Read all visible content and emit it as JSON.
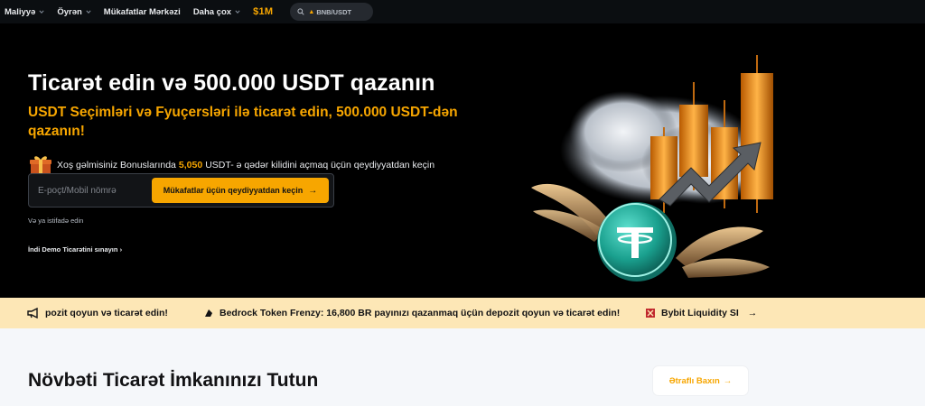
{
  "nav": {
    "items": [
      {
        "label": "Maliyyə",
        "has_dropdown": true
      },
      {
        "label": "Öyrən",
        "has_dropdown": true
      },
      {
        "label": "Mükafatlar Mərkəzi",
        "has_dropdown": false
      },
      {
        "label": "Daha çox",
        "has_dropdown": true
      }
    ],
    "badge": "$1M",
    "search_value": "BNB/USDT"
  },
  "hero": {
    "title": "Ticarət edin və 500.000 USDT qazanın",
    "subtitle": "USDT Seçimləri və Fyuçersləri ilə ticarət edin, 500.000 USDT-dən qazanın!",
    "bonus_prefix": "Xoş gəlmisiniz Bonuslarında",
    "bonus_amount": "5,050",
    "bonus_suffix": "USDT- ə qədər kilidini açmaq üçün qeydiyyatdan keçin",
    "input_placeholder": "E-poçt/Mobil nömrə",
    "signup_button": "Mükafatlar üçün qeydiyyatdan keçin",
    "alt_signup": "Və ya istifadə edin",
    "demo_link": "İndi Demo Ticarətini sınayın"
  },
  "ticker": {
    "items": [
      "pozit qoyun və ticarət edin!",
      "Bedrock Token Frenzy: 16,800 BR payınızı qazanmaq üçün depozit qoyun və ticarət edin!",
      "Bybit Liquidity SI"
    ]
  },
  "section": {
    "title": "Növbəti Ticarət İmkanınızı Tutun",
    "more_button": "Ətraflı Baxın"
  },
  "colors": {
    "accent": "#f7a600",
    "hero_bg": "#000000",
    "nav_bg": "#0b0e11",
    "ticker_bg": "#fde7b6",
    "section_bg": "#f5f7fa"
  }
}
